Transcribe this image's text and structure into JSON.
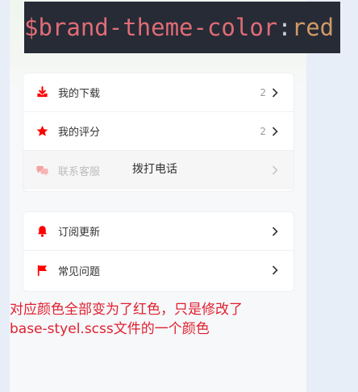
{
  "colors": {
    "brand": "#ff0000",
    "code_bg": "#262b36"
  },
  "code_line": {
    "variable": "$brand-theme-color",
    "colon": ":",
    "value": "red",
    "semicolon": ";"
  },
  "menu_group1": [
    {
      "label": "我的下载",
      "count": "2",
      "icon": "download-icon"
    },
    {
      "label": "我的评分",
      "count": "2",
      "icon": "star-icon"
    },
    {
      "label": "联系客服",
      "extra": "拨打电话",
      "icon": "chat-icon",
      "disabled": true
    }
  ],
  "menu_group2": [
    {
      "label": "订阅更新",
      "icon": "bell-icon"
    },
    {
      "label": "常见问题",
      "icon": "flag-icon"
    }
  ],
  "annotation": {
    "line1": "对应颜色全部变为了红色，只是修改了",
    "line2": "base-styel.scss文件的一个颜色"
  }
}
